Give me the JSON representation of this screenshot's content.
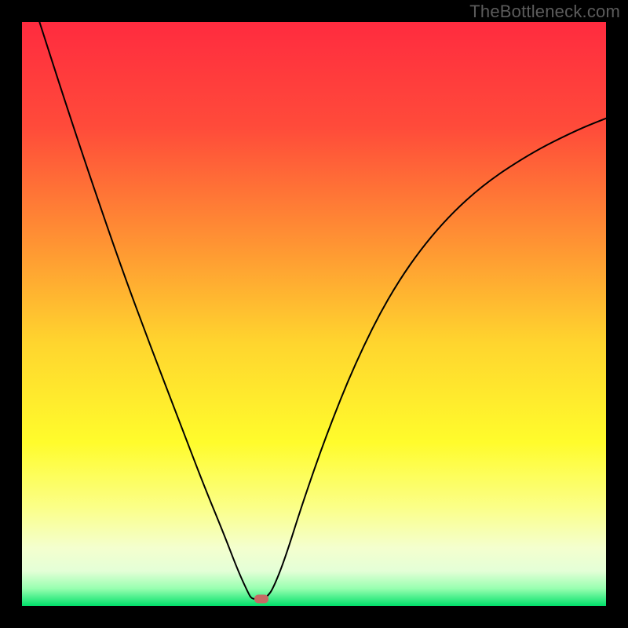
{
  "watermark": {
    "text": "TheBottleneck.com"
  },
  "chart_data": {
    "type": "line",
    "title": "",
    "xlabel": "",
    "ylabel": "",
    "xlim": [
      0,
      100
    ],
    "ylim": [
      0,
      100
    ],
    "gradient_stops": [
      {
        "offset": 0,
        "color": "#ff2b3f"
      },
      {
        "offset": 18,
        "color": "#ff4b3a"
      },
      {
        "offset": 38,
        "color": "#ff9433"
      },
      {
        "offset": 55,
        "color": "#ffd52e"
      },
      {
        "offset": 72,
        "color": "#fffc2c"
      },
      {
        "offset": 83,
        "color": "#fbff87"
      },
      {
        "offset": 90,
        "color": "#f4ffce"
      },
      {
        "offset": 94,
        "color": "#e4ffd7"
      },
      {
        "offset": 97,
        "color": "#98ffb0"
      },
      {
        "offset": 100,
        "color": "#00e06a"
      }
    ],
    "series": [
      {
        "name": "bottleneck-curve",
        "points": [
          {
            "x": 3.0,
            "y": 100.0
          },
          {
            "x": 7.5,
            "y": 86.0
          },
          {
            "x": 12.0,
            "y": 72.5
          },
          {
            "x": 17.0,
            "y": 58.0
          },
          {
            "x": 22.0,
            "y": 44.5
          },
          {
            "x": 27.0,
            "y": 31.5
          },
          {
            "x": 31.0,
            "y": 21.0
          },
          {
            "x": 34.5,
            "y": 12.5
          },
          {
            "x": 37.0,
            "y": 6.0
          },
          {
            "x": 38.8,
            "y": 2.1
          },
          {
            "x": 39.3,
            "y": 1.3
          },
          {
            "x": 40.0,
            "y": 1.2
          },
          {
            "x": 41.0,
            "y": 1.2
          },
          {
            "x": 42.0,
            "y": 1.6
          },
          {
            "x": 43.0,
            "y": 3.0
          },
          {
            "x": 45.0,
            "y": 8.0
          },
          {
            "x": 48.0,
            "y": 17.5
          },
          {
            "x": 52.0,
            "y": 29.0
          },
          {
            "x": 57.0,
            "y": 41.5
          },
          {
            "x": 63.0,
            "y": 53.5
          },
          {
            "x": 70.0,
            "y": 63.5
          },
          {
            "x": 78.0,
            "y": 71.5
          },
          {
            "x": 87.0,
            "y": 77.5
          },
          {
            "x": 95.0,
            "y": 81.5
          },
          {
            "x": 100.0,
            "y": 83.5
          }
        ]
      }
    ],
    "marker": {
      "x": 41.0,
      "y": 1.2,
      "color": "#c76a64"
    }
  }
}
